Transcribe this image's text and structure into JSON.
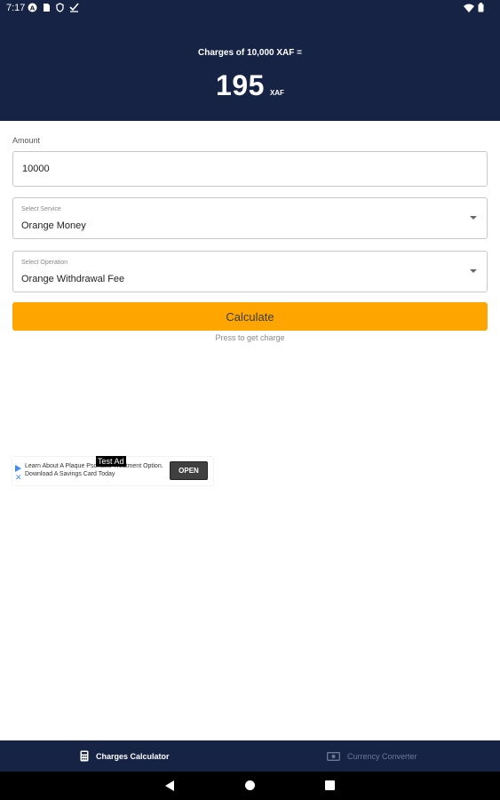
{
  "status_bar": {
    "time": "7:17"
  },
  "header": {
    "charges_label": "Charges of 10,000 XAF =",
    "charges_value": "195",
    "charges_unit": "XAF"
  },
  "form": {
    "amount_label": "Amount",
    "amount_value": "10000",
    "service": {
      "label": "Select Service",
      "value": "Orange Money"
    },
    "operation": {
      "label": "Select Operation",
      "value": "Orange Withdrawal Fee"
    },
    "calculate_label": "Calculate",
    "calculate_hint": "Press to get charge"
  },
  "ad": {
    "tag": "Test Ad",
    "text": "Learn About A Plaque Psoriasis Treatment Option. Download A Savings Card Today",
    "open_label": "OPEN"
  },
  "tabs": [
    {
      "label": "Charges Calculator",
      "icon": "calculator-icon",
      "active": true
    },
    {
      "label": "Currency Converter",
      "icon": "money-icon",
      "active": false
    }
  ],
  "colors": {
    "header_bg": "#162345",
    "accent": "#ffa500",
    "tab_inactive": "#6e7899"
  }
}
